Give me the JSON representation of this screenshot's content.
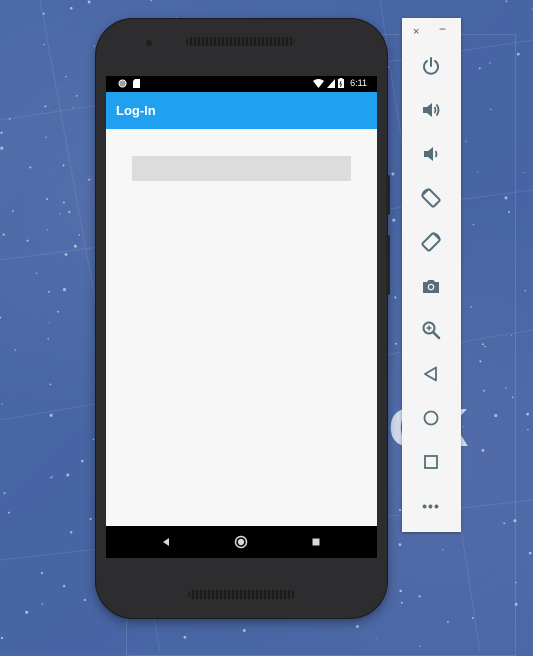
{
  "device": {
    "status_bar": {
      "time": "6:11",
      "icons": [
        "sync-icon",
        "sd-card-icon",
        "wifi-icon",
        "signal-icon",
        "battery-icon"
      ]
    },
    "app": {
      "title": "Log-In",
      "accent_color": "#1fa1ef",
      "content_background": "#f7f7f7"
    },
    "navigation": {
      "buttons": [
        "back-icon",
        "home-icon",
        "recents-icon"
      ]
    }
  },
  "emulator_toolbar": {
    "window_controls": {
      "close": "×",
      "minimize": "−"
    },
    "buttons": [
      "power-icon",
      "volume-up-icon",
      "volume-down-icon",
      "rotate-left-icon",
      "rotate-right-icon",
      "camera-icon",
      "zoom-icon",
      "back-icon",
      "home-icon",
      "overview-icon",
      "more-icon"
    ],
    "more_label": "•••",
    "icon_color": "#546e7a"
  }
}
